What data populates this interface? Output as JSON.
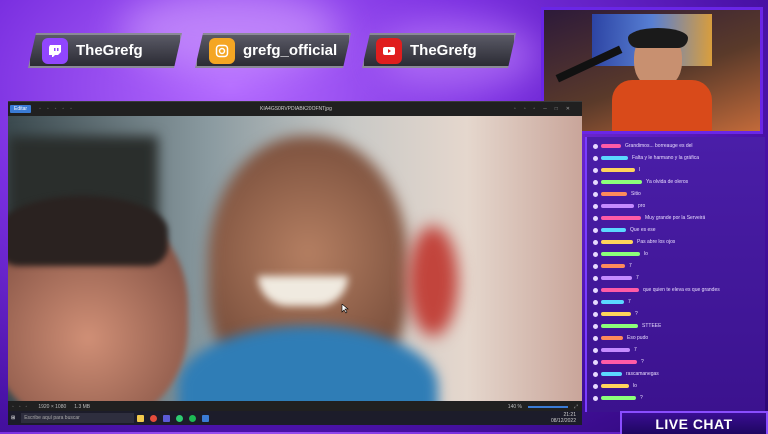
{
  "socials": [
    {
      "label": "TheGrefg",
      "platform": "twitch",
      "color": "#9146ff"
    },
    {
      "label": "grefg_official",
      "platform": "instagram",
      "color": "#f5a623"
    },
    {
      "label": "TheGrefg",
      "platform": "youtube",
      "color": "#e01e1e"
    }
  ],
  "viewer": {
    "filename": "KIA4GS0RVPDIABK20OFNTjpg",
    "button_label": "Editar",
    "zoom": "140 %",
    "dimensions": "1920 × 1080",
    "filesize": "1.3 MB"
  },
  "taskbar": {
    "search_placeholder": "Escribe aquí para buscar",
    "time": "21:21",
    "date": "08/12/2022"
  },
  "chat": {
    "title": "LIVE CHAT",
    "messages": [
      {
        "user": "",
        "text": "Grandimos... borreauge es del"
      },
      {
        "user": "",
        "text": "Falta y le harmano y la gráfica"
      },
      {
        "user": "",
        "text": "l"
      },
      {
        "user": "",
        "text": "Ya olvida de oleros"
      },
      {
        "user": "",
        "text": "Sitio"
      },
      {
        "user": "",
        "text": "pro"
      },
      {
        "user": "",
        "text": "Muy grande por la Serveirá"
      },
      {
        "user": "",
        "text": "Que es ese"
      },
      {
        "user": "",
        "text": "Pas abre los ojos"
      },
      {
        "user": "",
        "text": "lo"
      },
      {
        "user": "",
        "text": "7"
      },
      {
        "user": "",
        "text": "7"
      },
      {
        "user": "",
        "text": "que quien te eleva es que grandes"
      },
      {
        "user": "",
        "text": "7"
      },
      {
        "user": "",
        "text": "?"
      },
      {
        "user": "",
        "text": "STTEEE"
      },
      {
        "user": "",
        "text": "Eso pudo"
      },
      {
        "user": "",
        "text": "7"
      },
      {
        "user": "",
        "text": "?"
      },
      {
        "user": "",
        "text": "rascamanegas"
      },
      {
        "user": "",
        "text": "lo"
      },
      {
        "user": "",
        "text": "?"
      }
    ]
  }
}
